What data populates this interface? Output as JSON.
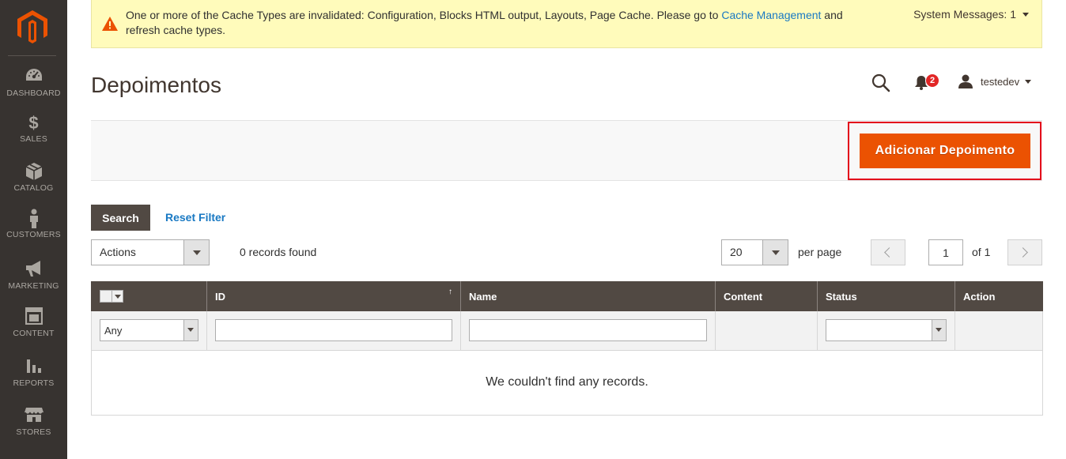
{
  "sidebar": {
    "items": [
      {
        "label": "DASHBOARD",
        "icon": "dashboard-icon"
      },
      {
        "label": "SALES",
        "icon": "dollar-icon"
      },
      {
        "label": "CATALOG",
        "icon": "box-icon"
      },
      {
        "label": "CUSTOMERS",
        "icon": "person-icon"
      },
      {
        "label": "MARKETING",
        "icon": "megaphone-icon"
      },
      {
        "label": "CONTENT",
        "icon": "layout-icon"
      },
      {
        "label": "REPORTS",
        "icon": "bar-chart-icon"
      },
      {
        "label": "STORES",
        "icon": "store-icon"
      }
    ]
  },
  "system_message": {
    "text_before": "One or more of the Cache Types are invalidated: Configuration, Blocks HTML output, Layouts, Page Cache. Please go to ",
    "link_text": "Cache Management",
    "text_after": " and refresh cache types.",
    "count_label": "System Messages: 1"
  },
  "header": {
    "title": "Depoimentos",
    "notification_count": "2",
    "username": "testedev"
  },
  "actionbar": {
    "add_label": "Adicionar Depoimento"
  },
  "filters": {
    "search_label": "Search",
    "reset_label": "Reset Filter"
  },
  "toolbar": {
    "actions_label": "Actions",
    "records_found": "0 records found",
    "per_page_value": "20",
    "per_page_label": "per page",
    "page_value": "1",
    "page_of": "of 1"
  },
  "grid": {
    "columns": [
      "",
      "ID",
      "Name",
      "Content",
      "Status",
      "Action"
    ],
    "sort_indicator": "↑",
    "filter_any": "Any",
    "empty_message": "We couldn't find any records."
  },
  "colors": {
    "sidebar_bg": "#373330",
    "accent": "#eb5202",
    "header_bg": "#514943",
    "link": "#1979c3",
    "message_bg": "#fffbbb"
  }
}
